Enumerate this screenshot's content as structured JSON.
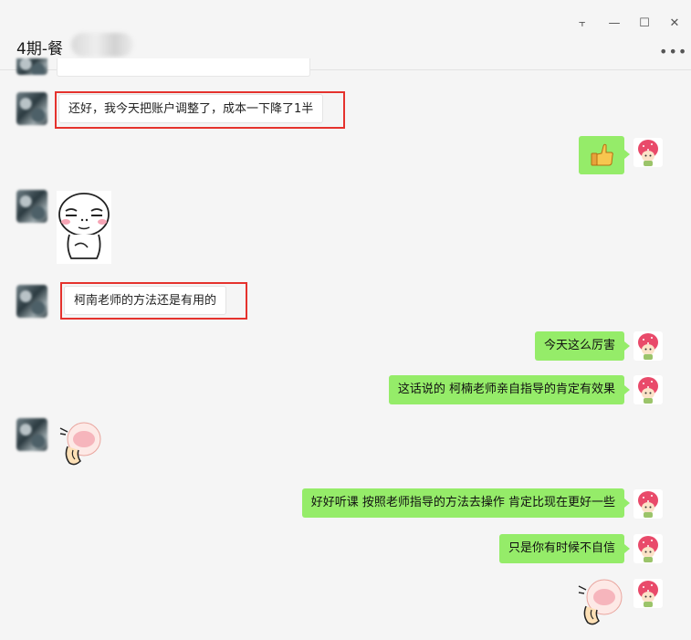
{
  "window": {
    "title": "4期-餐",
    "pin_glyph": "⫟",
    "minimize_glyph": "—",
    "maximize_glyph": "☐",
    "close_glyph": "✕",
    "more_glyph": "•••"
  },
  "messages": [
    {
      "side": "left",
      "type": "text",
      "text": "还好，我今天把账户调整了，成本一下降了1半",
      "highlighted": true
    },
    {
      "side": "right",
      "type": "emoji",
      "emoji": "thumbs-up"
    },
    {
      "side": "left",
      "type": "sticker",
      "sticker": "smug-face-sticker"
    },
    {
      "side": "left",
      "type": "text",
      "text": "柯南老师的方法还是有用的",
      "highlighted": true
    },
    {
      "side": "right",
      "type": "text",
      "text": "今天这么厉害"
    },
    {
      "side": "right",
      "type": "text",
      "text": "这话说的 柯楠老师亲自指导的肯定有效果"
    },
    {
      "side": "left",
      "type": "sticker",
      "sticker": "blushing-peach-sticker"
    },
    {
      "side": "right",
      "type": "text",
      "text": "好好听课 按照老师指导的方法去操作 肯定比现在更好一些"
    },
    {
      "side": "right",
      "type": "text",
      "text": "只是你有时候不自信"
    },
    {
      "side": "right",
      "type": "sticker",
      "sticker": "blushing-peach-sticker"
    }
  ],
  "colors": {
    "bubble_green": "#95ec69",
    "bubble_white": "#ffffff",
    "highlight_red": "#e5322d",
    "background": "#f5f5f5"
  }
}
